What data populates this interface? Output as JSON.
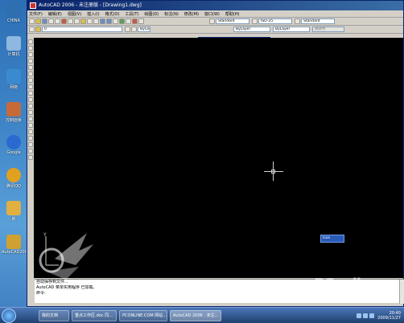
{
  "desktop": {
    "icons": [
      {
        "label": "CHINA",
        "color": "#2f6fb0"
      },
      {
        "label": "计算机",
        "color": "#8fb8e0"
      },
      {
        "label": "网络",
        "color": "#3a8ad0"
      },
      {
        "label": "控制面板",
        "color": "#c66a3a"
      },
      {
        "label": "Google",
        "color": "#2a6ad0"
      },
      {
        "label": "腾讯QQ",
        "color": "#e0a020"
      },
      {
        "label": "新",
        "color": "#e0b040"
      },
      {
        "label": "AutoCAD2006",
        "color": "#d0a030"
      }
    ]
  },
  "window": {
    "title": "AutoCAD 2006 - 未注册版 - [Drawing1.dwg]"
  },
  "menu": [
    "文件(F)",
    "编辑(E)",
    "视图(V)",
    "插入(I)",
    "格式(O)",
    "工具(T)",
    "绘图(D)",
    "标注(N)",
    "修改(M)",
    "窗口(W)",
    "帮助(H)"
  ],
  "toolbar": {
    "text_style": "Standard",
    "dim_style": "ISO-25",
    "table_style": "Standard",
    "layer": "0",
    "color": "ByLayer",
    "linetype": "ByLayer",
    "lineweight": "ByLayer",
    "plot_style": "随颜色"
  },
  "toolpalette": {
    "title": "工作空间",
    "workspace": "AutoCAD 默认"
  },
  "command_line": [
    "自动保存到文件...",
    "AutoCAD 菜单实用程序 已加载。",
    "命令:"
  ],
  "mini_panel": {
    "label": "Icon"
  },
  "watermark": {
    "brand": "PConline",
    "sub": "太平洋电脑网"
  },
  "taskbar": {
    "tasks": [
      {
        "label": "我的文档",
        "active": false
      },
      {
        "label": "重点工作区.doc 同...",
        "active": false
      },
      {
        "label": "PCONLINE.COM 网站...",
        "active": false
      },
      {
        "label": "AutoCAD 2006 - 未注...",
        "active": true
      }
    ],
    "time": "20:40",
    "date": "2009/11/27"
  }
}
